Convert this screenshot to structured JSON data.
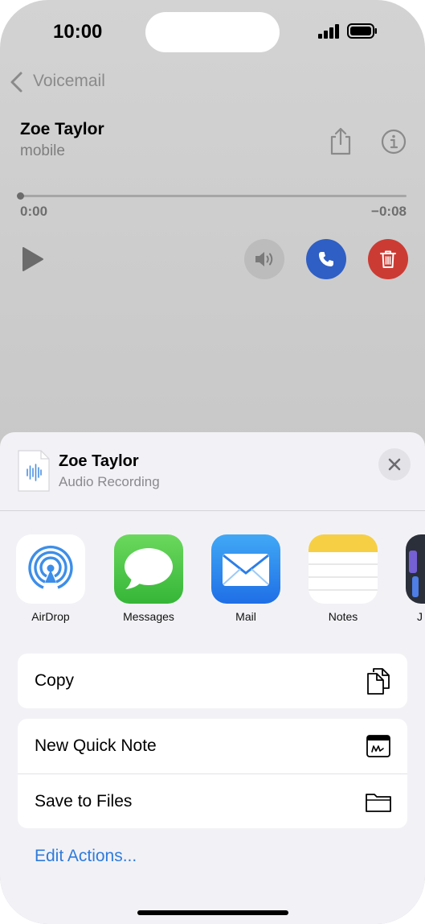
{
  "status_bar": {
    "time": "10:00"
  },
  "nav": {
    "back_label": "Voicemail"
  },
  "voicemail": {
    "name": "Zoe Taylor",
    "label": "mobile",
    "elapsed": "0:00",
    "remaining": "−0:08",
    "progress": 0.0
  },
  "share_sheet": {
    "title": "Zoe Taylor",
    "subtitle": "Audio Recording",
    "apps": [
      {
        "label": "AirDrop",
        "icon": "airdrop-icon"
      },
      {
        "label": "Messages",
        "icon": "messages-icon"
      },
      {
        "label": "Mail",
        "icon": "mail-icon"
      },
      {
        "label": "Notes",
        "icon": "notes-icon"
      },
      {
        "label": "J",
        "icon": "app-icon"
      }
    ],
    "actions": {
      "copy": "Copy",
      "new_quick_note": "New Quick Note",
      "save_to_files": "Save to Files"
    },
    "edit_actions": "Edit Actions..."
  },
  "colors": {
    "call": "#2f5fc4",
    "delete": "#cc3b33",
    "link": "#2f7bdc"
  }
}
